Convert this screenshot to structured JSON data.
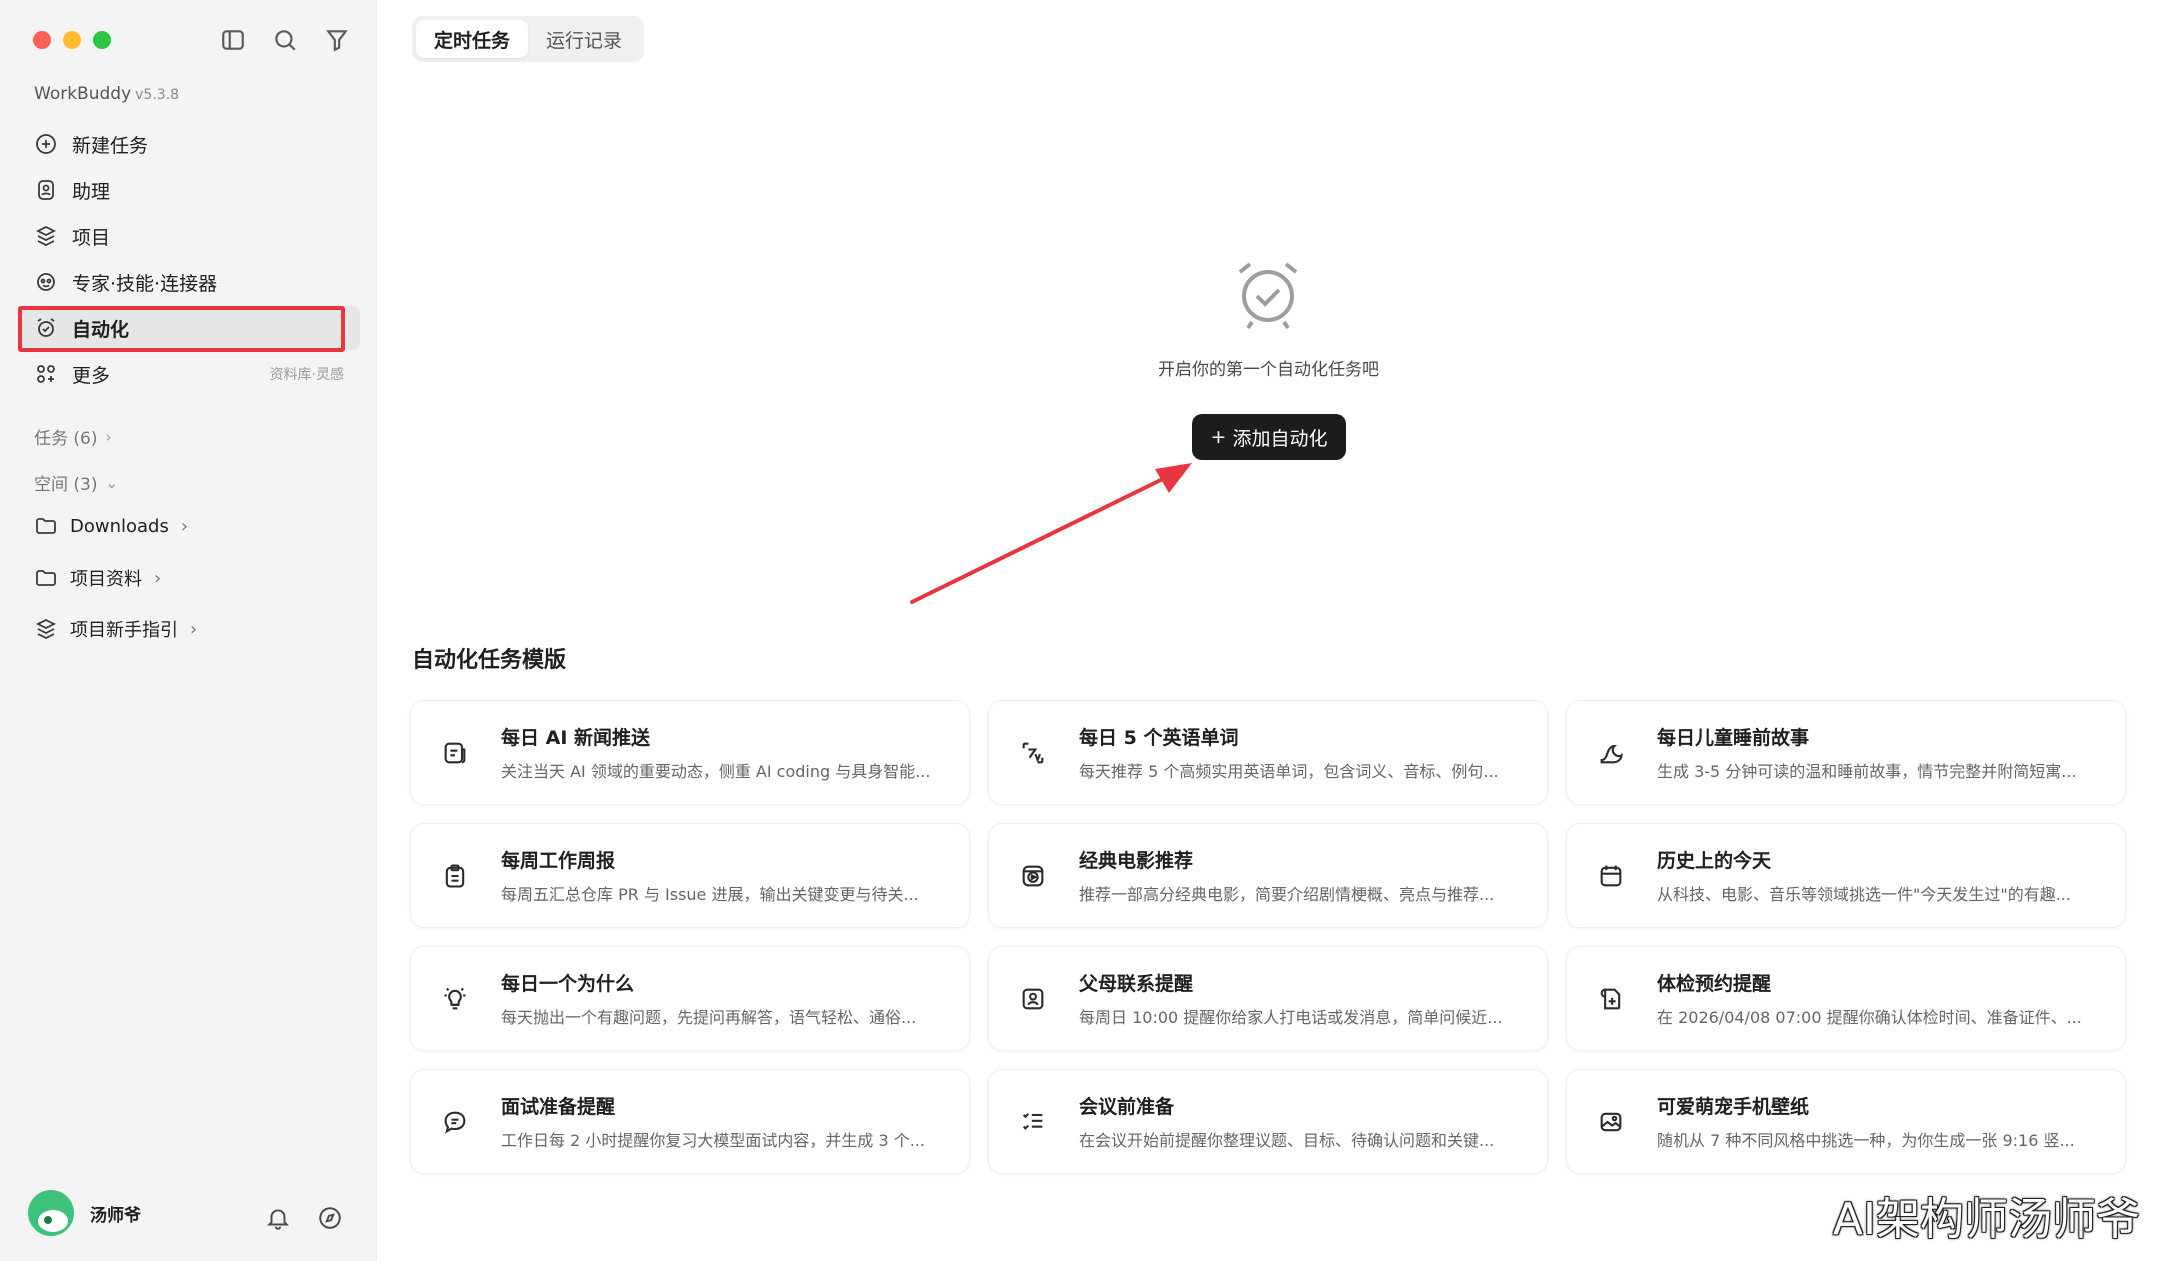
{
  "app": {
    "name": "WorkBuddy",
    "version": "v5.3.8"
  },
  "window": {
    "controls": [
      "close",
      "minimize",
      "zoom"
    ]
  },
  "sidebar": {
    "nav": [
      {
        "label": "新建任务",
        "icon": "plus-circle-icon"
      },
      {
        "label": "助理",
        "icon": "assistant-icon"
      },
      {
        "label": "项目",
        "icon": "project-icon"
      },
      {
        "label": "专家·技能·连接器",
        "icon": "expert-icon"
      },
      {
        "label": "自动化",
        "icon": "alarm-clock-icon",
        "active": true
      },
      {
        "label": "更多",
        "icon": "apps-icon",
        "hint": "资料库·灵感"
      }
    ],
    "sections": {
      "tasks": "任务 (6)",
      "spaces": "空间 (3)"
    },
    "folders": [
      {
        "label": "Downloads"
      },
      {
        "label": "项目资料"
      },
      {
        "label": "项目新手指引"
      }
    ],
    "user": {
      "name": "汤师爷"
    }
  },
  "main": {
    "tabs": [
      {
        "label": "定时任务",
        "active": true
      },
      {
        "label": "运行记录",
        "active": false
      }
    ],
    "empty_state": {
      "text": "开启你的第一个自动化任务吧",
      "button": "添加自动化"
    },
    "templates_title": "自动化任务模版",
    "templates": [
      {
        "title": "每日 AI 新闻推送",
        "desc": "关注当天 AI 领域的重要动态，侧重 AI coding 与具身智能...",
        "icon": "news-icon"
      },
      {
        "title": "每日 5 个英语单词",
        "desc": "每天推荐 5 个高频实用英语单词，包含词义、音标、例句...",
        "icon": "translate-icon"
      },
      {
        "title": "每日儿童睡前故事",
        "desc": "生成 3-5 分钟可读的温和睡前故事，情节完整并附简短寓...",
        "icon": "moon-icon"
      },
      {
        "title": "每周工作周报",
        "desc": "每周五汇总仓库 PR 与 Issue 进展，输出关键变更与待关...",
        "icon": "clipboard-icon"
      },
      {
        "title": "经典电影推荐",
        "desc": "推荐一部高分经典电影，简要介绍剧情梗概、亮点与推荐...",
        "icon": "film-icon"
      },
      {
        "title": "历史上的今天",
        "desc": "从科技、电影、音乐等领域挑选一件\"今天发生过\"的有趣...",
        "icon": "calendar-icon"
      },
      {
        "title": "每日一个为什么",
        "desc": "每天抛出一个有趣问题，先提问再解答，语气轻松、通俗...",
        "icon": "lightbulb-icon"
      },
      {
        "title": "父母联系提醒",
        "desc": "每周日 10:00 提醒你给家人打电话或发消息，简单问候近...",
        "icon": "contact-icon"
      },
      {
        "title": "体检预约提醒",
        "desc": "在 2026/04/08 07:00 提醒你确认体检时间、准备证件、...",
        "icon": "health-icon"
      },
      {
        "title": "面试准备提醒",
        "desc": "工作日每 2 小时提醒你复习大模型面试内容，并生成 3 个...",
        "icon": "chat-icon"
      },
      {
        "title": "会议前准备",
        "desc": "在会议开始前提醒你整理议题、目标、待确认问题和关键...",
        "icon": "checklist-icon"
      },
      {
        "title": "可爱萌宠手机壁纸",
        "desc": "随机从 7 种不同风格中挑选一种，为你生成一张 9:16 竖...",
        "icon": "image-icon"
      }
    ]
  },
  "watermark": "AI架构师汤师爷",
  "colors": {
    "highlight": "#e8363f",
    "primary_button": "#1c1c1c",
    "sidebar_bg": "#f4f4f4"
  }
}
